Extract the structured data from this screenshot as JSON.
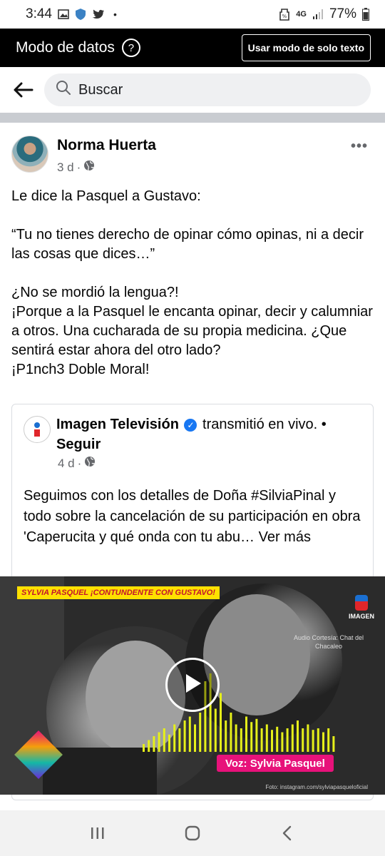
{
  "status_bar": {
    "time": "3:44",
    "battery": "77%",
    "network": "4G"
  },
  "data_mode": {
    "title": "Modo de datos",
    "help_icon": "?",
    "text_mode_button": "Usar modo de solo texto"
  },
  "search": {
    "placeholder": "Buscar"
  },
  "post": {
    "author": "Norma Huerta",
    "time": "3 d",
    "more": "•••",
    "paragraphs": [
      "Le dice la Pasquel a Gustavo:",
      "“Tu no tienes derecho de opinar cómo opinas, ni a decir las cosas que dices…”",
      "¿No se mordió la lengua?!",
      "¡Porque a la Pasquel le encanta opinar, decir y calumniar a otros. Una cucharada de su propia medicina. ¿Que sentirá estar ahora del otro lado?",
      "¡P1nch3 Doble Moral!"
    ]
  },
  "shared": {
    "page_name": "Imagen Televisión",
    "action": "transmitió en vivo.",
    "follow": "Seguir",
    "time": "4 d",
    "text": "Seguimos con los detalles de Doña #SilviaPinal y todo sobre la cancelación de su participación en obra 'Caperucita y qué onda con tu abu… Ver más"
  },
  "video": {
    "banner": "SYLVIA PASQUEL ¡CONTUNDENTE CON GUSTAVO!",
    "brand": "IMAGEN",
    "credit": "Audio Cortesía: Chat del Chacaleo",
    "voice_tag": "Voz: Sylvia Pasquel",
    "footer": "Foto: instagram.com/sylviapasqueloficial",
    "bar_levels": [
      0.1,
      0.15,
      0.2,
      0.25,
      0.3,
      0.22,
      0.35,
      0.3,
      0.4,
      0.45,
      0.35,
      0.5,
      0.9,
      1.0,
      0.55,
      0.75,
      0.4,
      0.5,
      0.35,
      0.3,
      0.45,
      0.38,
      0.42,
      0.3,
      0.35,
      0.28,
      0.32,
      0.25,
      0.3,
      0.35,
      0.4,
      0.3,
      0.35,
      0.28,
      0.3,
      0.25,
      0.3,
      0.2
    ]
  },
  "accent_colors": {
    "verified": "#1877f2",
    "banner": "#ffe100",
    "voice_tag": "#e7127a",
    "wave": "#e6f01a"
  }
}
